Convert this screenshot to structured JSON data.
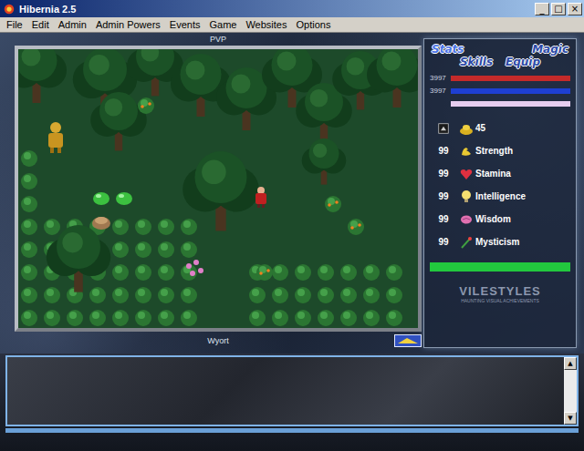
{
  "window": {
    "title": "Hibernia 2.5",
    "controls": [
      "_",
      "□",
      "×"
    ]
  },
  "menu": [
    "File",
    "Edit",
    "Admin",
    "Admin Powers",
    "Events",
    "Game",
    "Websites",
    "Options"
  ],
  "map": {
    "title": "PVP"
  },
  "player": {
    "name": "Wyort"
  },
  "tabs": [
    {
      "label": "Stats",
      "selected": true
    },
    {
      "label": "Magic",
      "selected": false
    },
    {
      "label": "Skills",
      "selected": false
    },
    {
      "label": "Equip",
      "selected": false
    }
  ],
  "bars": [
    {
      "reading": "3997",
      "level": 1,
      "color": "#c42a2a"
    },
    {
      "reading": "3997",
      "level": 1,
      "color": "#1e3fd2"
    },
    {
      "reading": "",
      "level": 1,
      "color": "#e6cdf0"
    }
  ],
  "gold": "45",
  "stats": [
    {
      "value": "99",
      "label": "Strength"
    },
    {
      "value": "99",
      "label": "Stamina"
    },
    {
      "value": "99",
      "label": "Intelligence"
    },
    {
      "value": "99",
      "label": "Wisdom"
    },
    {
      "value": "99",
      "label": "Mysticism"
    }
  ],
  "progress": {
    "level": 1,
    "color": "#22c83e"
  },
  "watermark": {
    "title": "VILESTYLES",
    "subtitle": "HAUNTING VISUAL ACHIEVEMENTS"
  },
  "chat": {
    "lines": []
  },
  "scroll": {
    "up": "▲",
    "down": "▼"
  }
}
